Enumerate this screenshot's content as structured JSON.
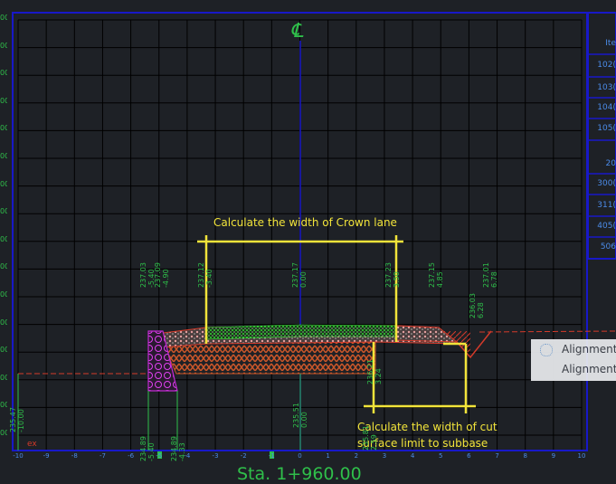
{
  "annotations": {
    "crown_lane": "Calculate the width of Crown lane",
    "cut_surface_line1": "Calculate the width of cut",
    "cut_surface_line2": "surface limit to subbase"
  },
  "centerline_symbol": "℄",
  "station_label": "Sta. 1+960.00",
  "tooltip_items": [
    "Alignment",
    "Alignment"
  ],
  "x_ticks": [
    "-10",
    "-9",
    "-8",
    "-7",
    "-6",
    "-5",
    "-4",
    "-3",
    "-2",
    "-1",
    "0",
    "1",
    "2",
    "3",
    "4",
    "5",
    "6",
    "7",
    "8",
    "9",
    "10"
  ],
  "y_labels": [
    "00",
    "00",
    "00",
    "00",
    "00",
    "00",
    "00",
    "00",
    "00",
    "00",
    "00",
    "00",
    "00",
    "00",
    "00",
    "00"
  ],
  "right_table": [
    "Ite",
    "102(",
    "103(",
    "104(",
    "105(",
    "20",
    "300(",
    "311(",
    "405(",
    "506"
  ],
  "vertical_labels": [
    {
      "elev": "237.03",
      "off": "-5.40"
    },
    {
      "elev": "237.09",
      "off": "-4.90"
    },
    {
      "elev": "237.12",
      "off": "-3.40"
    },
    {
      "elev": "237.17",
      "off": "0.00"
    },
    {
      "elev": "237.23",
      "off": "3.50"
    },
    {
      "elev": "237.15",
      "off": "4.85"
    },
    {
      "elev": "237.01",
      "off": "6.78"
    },
    {
      "elev": "236.03",
      "off": "6.28"
    },
    {
      "elev": "236.21",
      "off": "3.24"
    },
    {
      "elev": "235.51",
      "off": "0.00"
    },
    {
      "elev": "234.89",
      "off": "-5.40"
    },
    {
      "elev": "234.89",
      "off": "-4.33"
    },
    {
      "elev": "235.47",
      "off": "-10.00"
    },
    {
      "elev": "235.81",
      "off": "2.59"
    }
  ],
  "colors": {
    "background": "#1e2126",
    "grid": "#000000",
    "frame": "#1818c8",
    "annotation": "#f2e43a",
    "label_green": "#2fbf4a",
    "label_blue": "#4b8be8",
    "pavement_red": "#d43a2a",
    "pavement_green": "#3cff3c",
    "subbase_brown": "#c8562a",
    "wall_magenta": "#c02ad0"
  }
}
